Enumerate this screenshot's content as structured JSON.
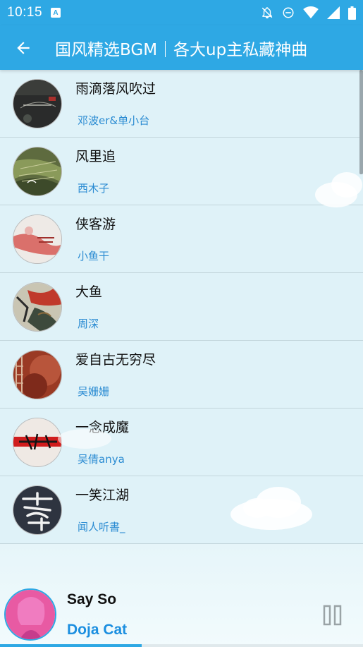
{
  "status_bar": {
    "time": "10:15",
    "app_icon_letter": "A",
    "icons": [
      "notifications-off-icon",
      "do-not-disturb-icon",
      "wifi-icon",
      "signal-icon",
      "battery-icon"
    ]
  },
  "app_bar": {
    "back_icon": "back-arrow-icon",
    "title": "国风精选BGM｜各大up主私藏神曲"
  },
  "songs": [
    {
      "title": "雨滴落风吹过",
      "artist": "邓波er&单小台"
    },
    {
      "title": "风里追",
      "artist": "西木子"
    },
    {
      "title": "侠客游",
      "artist": "小鱼干"
    },
    {
      "title": "大鱼",
      "artist": "周深"
    },
    {
      "title": "爱自古无穷尽",
      "artist": "吴姗姗"
    },
    {
      "title": "一念成魔",
      "artist": "吴倩anya"
    },
    {
      "title": "一笑江湖",
      "artist": "闻人听書_"
    }
  ],
  "player": {
    "title": "Say So",
    "artist": "Doja Cat",
    "progress_percent": 39,
    "control_icon": "pause-icon"
  },
  "colors": {
    "primary": "#2ea8e4",
    "background": "#dff2f8",
    "artist_text": "#2a8bd2",
    "player_artist": "#1c8fe0"
  }
}
